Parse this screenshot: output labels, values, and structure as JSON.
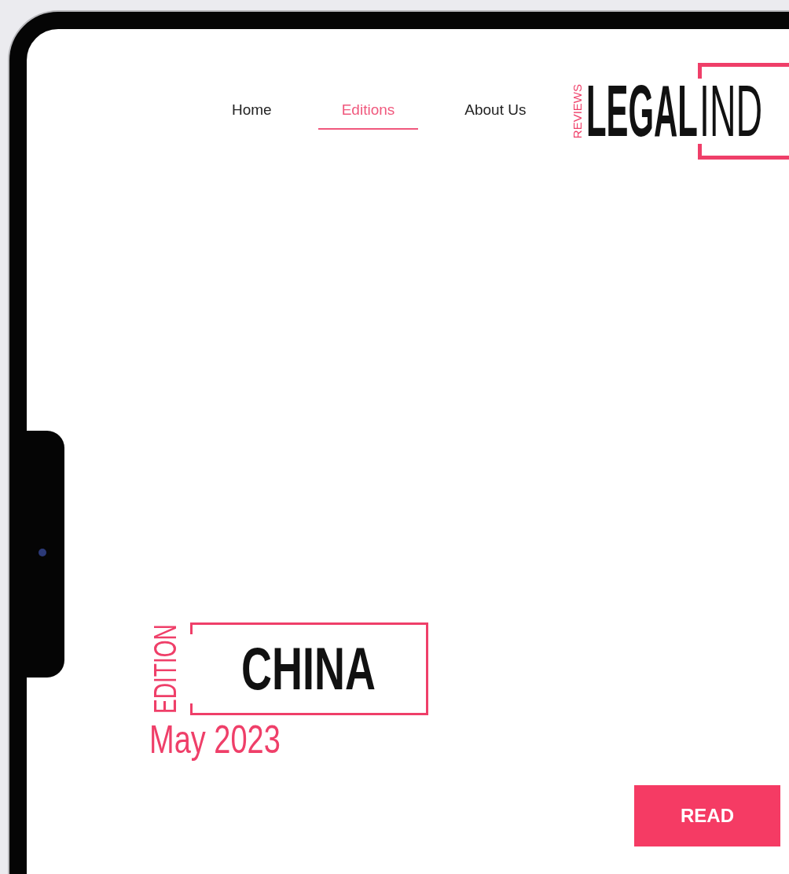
{
  "nav": {
    "items": [
      {
        "label": "Home",
        "selected": false
      },
      {
        "label": "Editions",
        "selected": true
      },
      {
        "label": "About Us",
        "selected": false
      }
    ]
  },
  "logo": {
    "tagline": "REVIEWS",
    "bold": "LEGAL",
    "light": "IND"
  },
  "edition": {
    "label": "EDITION",
    "country": "CHINA",
    "date": "May 2023"
  },
  "read_button": "READ"
}
